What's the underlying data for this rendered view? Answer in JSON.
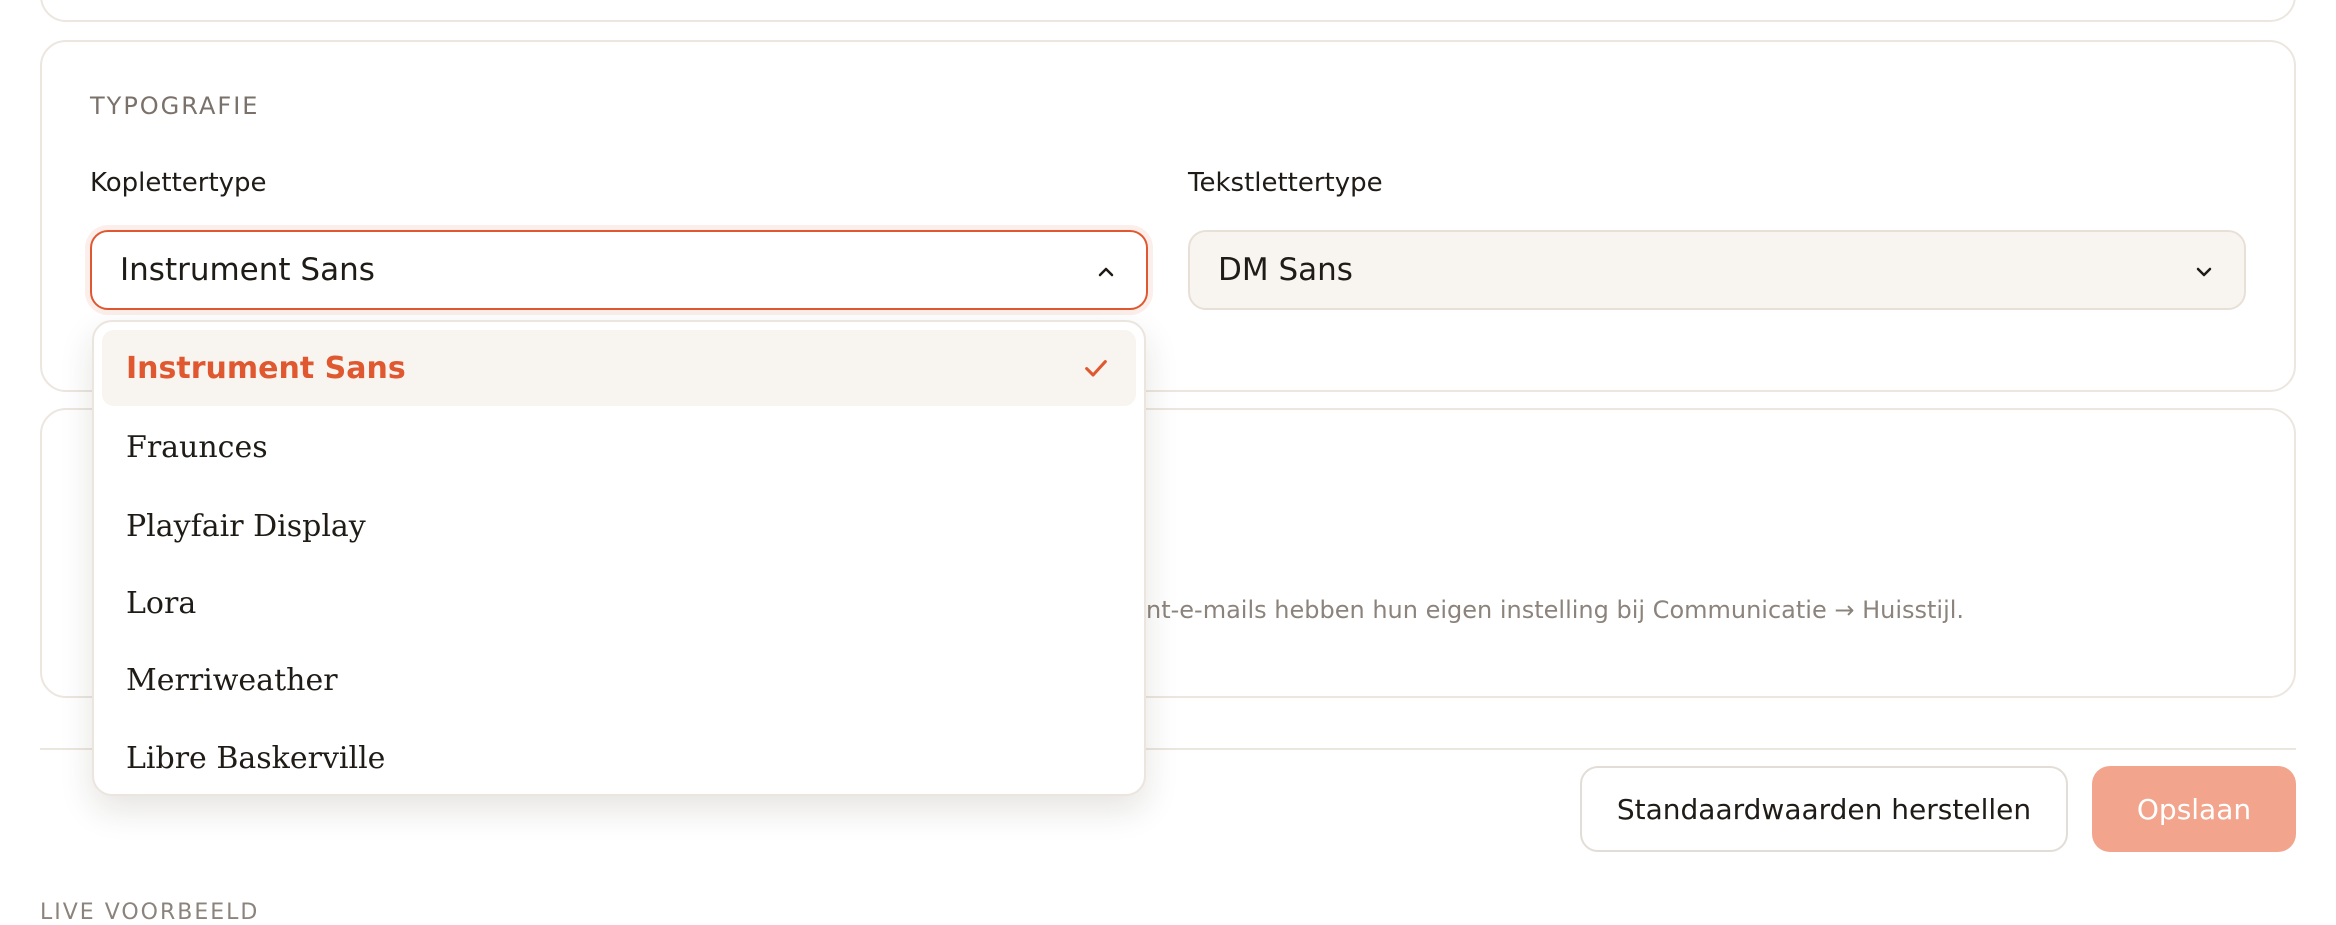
{
  "typography": {
    "section_title": "TYPOGRAFIE",
    "heading_font": {
      "label": "Koplettertype",
      "value": "Instrument Sans",
      "expanded": true,
      "options": [
        {
          "label": "Instrument Sans",
          "selected": true
        },
        {
          "label": "Fraunces",
          "selected": false
        },
        {
          "label": "Playfair Display",
          "selected": false
        },
        {
          "label": "Lora",
          "selected": false
        },
        {
          "label": "Merriweather",
          "selected": false
        },
        {
          "label": "Libre Baskerville",
          "selected": false
        }
      ]
    },
    "body_font": {
      "label": "Tekstlettertype",
      "value": "DM Sans",
      "expanded": false
    }
  },
  "hint_text": "nt-e-mails hebben hun eigen instelling bij Communicatie → Huisstijl.",
  "actions": {
    "reset_label": "Standaardwaarden herstellen",
    "save_label": "Opslaan"
  },
  "live_preview_label": "LIVE VOORBEELD",
  "colors": {
    "accent": "#e0582f",
    "save_button_disabled": "#f2a58c",
    "selected_option_bg": "#f8f4ef",
    "input_bg": "#f8f5f1"
  },
  "icons": {
    "heading_select_chevron": "chevron-up-icon",
    "body_select_chevron": "chevron-down-icon",
    "selected_option": "check-icon"
  }
}
